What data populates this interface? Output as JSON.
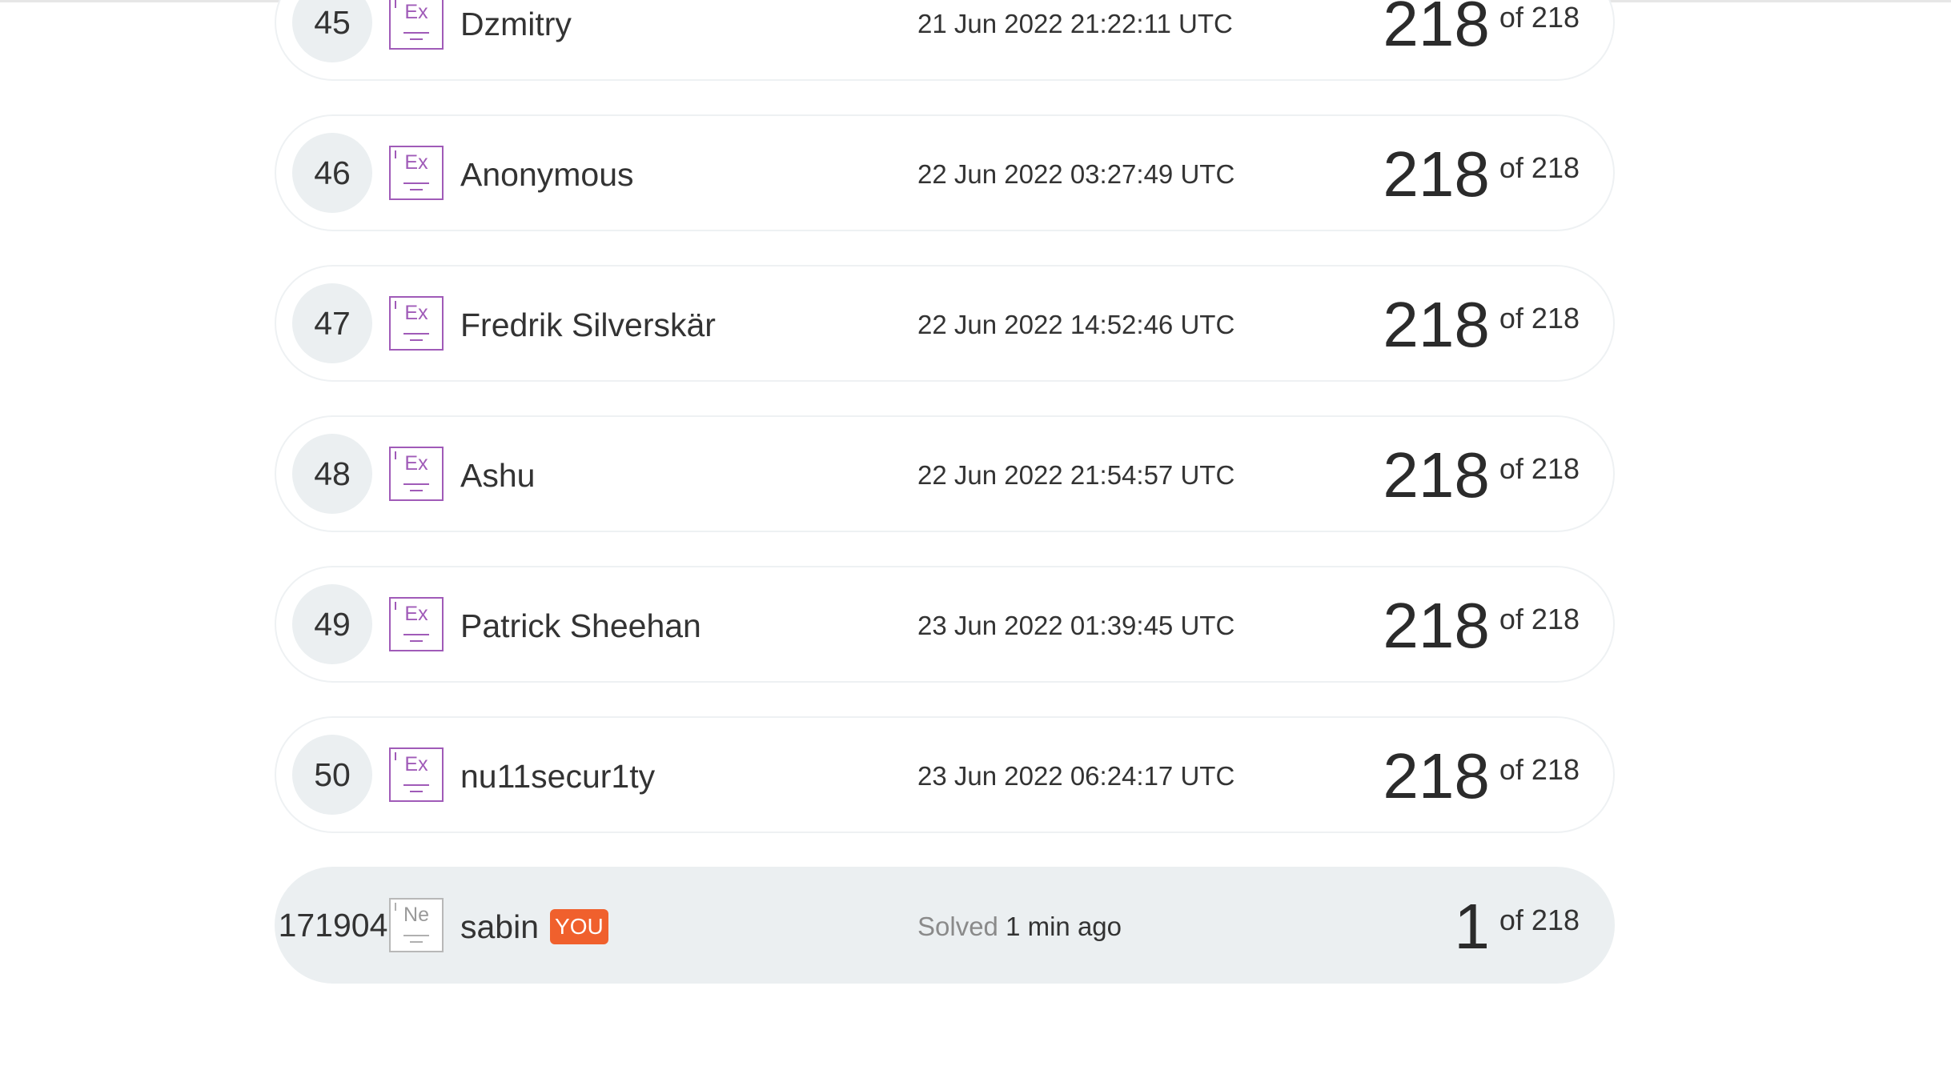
{
  "leaderboard": {
    "rows": [
      {
        "rank": "45",
        "level": "Ex",
        "name": "Dzmitry",
        "time": "21 Jun 2022 21:22:11 UTC",
        "score": "218",
        "of": "of 218"
      },
      {
        "rank": "46",
        "level": "Ex",
        "name": "Anonymous",
        "time": "22 Jun 2022 03:27:49 UTC",
        "score": "218",
        "of": "of 218"
      },
      {
        "rank": "47",
        "level": "Ex",
        "name": "Fredrik Silverskär",
        "time": "22 Jun 2022 14:52:46 UTC",
        "score": "218",
        "of": "of 218"
      },
      {
        "rank": "48",
        "level": "Ex",
        "name": "Ashu",
        "time": "22 Jun 2022 21:54:57 UTC",
        "score": "218",
        "of": "of 218"
      },
      {
        "rank": "49",
        "level": "Ex",
        "name": "Patrick Sheehan",
        "time": "23 Jun 2022 01:39:45 UTC",
        "score": "218",
        "of": "of 218"
      },
      {
        "rank": "50",
        "level": "Ex",
        "name": "nu11secur1ty",
        "time": "23 Jun 2022 06:24:17 UTC",
        "score": "218",
        "of": "of 218"
      }
    ],
    "you": {
      "rank": "171904",
      "level": "Ne",
      "name": "sabin",
      "badge": "YOU",
      "solved_label": "Solved",
      "solved_time": "1 min ago",
      "score": "1",
      "of": "of 218"
    }
  },
  "colors": {
    "expert_level": "#a05bb8",
    "newbie_level": "#b0b0b0",
    "you_badge": "#f0602d",
    "row_highlight": "#ebeff1",
    "rank_circle": "#ebeff1"
  },
  "icons": {
    "expert": "level-expert-icon",
    "newbie": "level-newbie-icon"
  }
}
